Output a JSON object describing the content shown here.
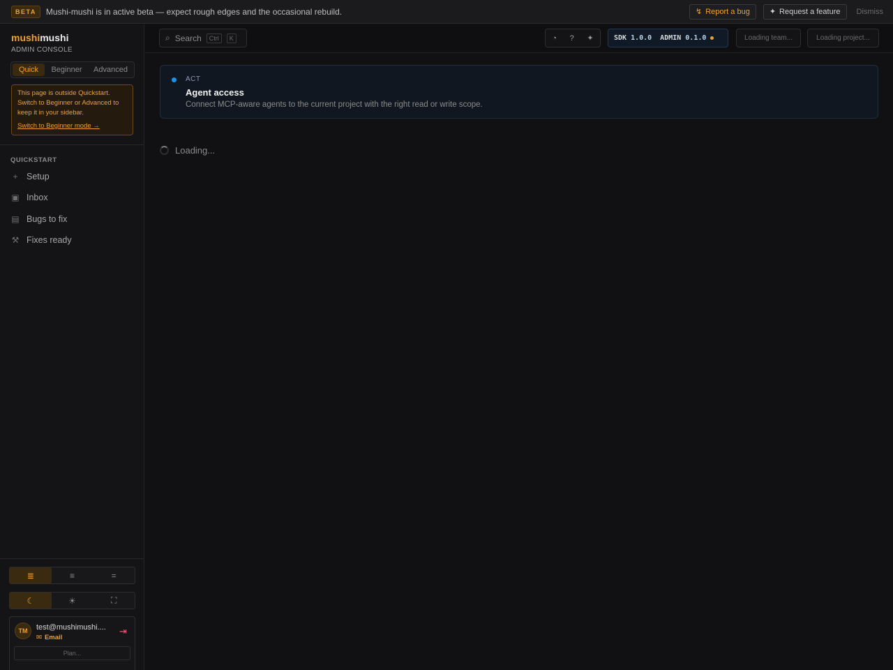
{
  "banner": {
    "badge": "BETA",
    "message": "Mushi-mushi is in active beta — expect rough edges and the occasional rebuild.",
    "report_bug": "Report a bug",
    "request_feature": "Request a feature",
    "dismiss": "Dismiss"
  },
  "brand": {
    "name_accent": "mushi",
    "name_rest": "mushi",
    "subtitle": "ADMIN CONSOLE"
  },
  "modes": {
    "items": [
      "Quick",
      "Beginner",
      "Advanced"
    ],
    "active": "Quick"
  },
  "notice": {
    "text": "This page is outside Quickstart. Switch to Beginner or Advanced to keep it in your sidebar.",
    "link": "Switch to Beginner mode →"
  },
  "nav": {
    "section": "QUICKSTART",
    "items": [
      {
        "label": "Setup",
        "icon": "plus-icon"
      },
      {
        "label": "Inbox",
        "icon": "inbox-icon"
      },
      {
        "label": "Bugs to fix",
        "icon": "list-icon"
      },
      {
        "label": "Fixes ready",
        "icon": "wrench-icon"
      }
    ]
  },
  "user": {
    "initials": "TM",
    "email": "test@mushimushi....",
    "method": "Email",
    "plan": "Plan..."
  },
  "topbar": {
    "search_label": "Search",
    "kbd_ctrl": "Ctrl",
    "kbd_k": "K",
    "sdk_label": "SDK",
    "sdk_version": "1.0.0",
    "admin_label": "ADMIN",
    "admin_version": "0.1.0",
    "team_loading": "Loading team...",
    "project_loading": "Loading project..."
  },
  "page": {
    "eyebrow": "ACT",
    "title": "Agent access",
    "description": "Connect MCP-aware agents to the current project with the right read or write scope.",
    "loading": "Loading..."
  },
  "colors": {
    "accent": "#f0a030",
    "info": "#1e90e8",
    "background": "#111113"
  }
}
